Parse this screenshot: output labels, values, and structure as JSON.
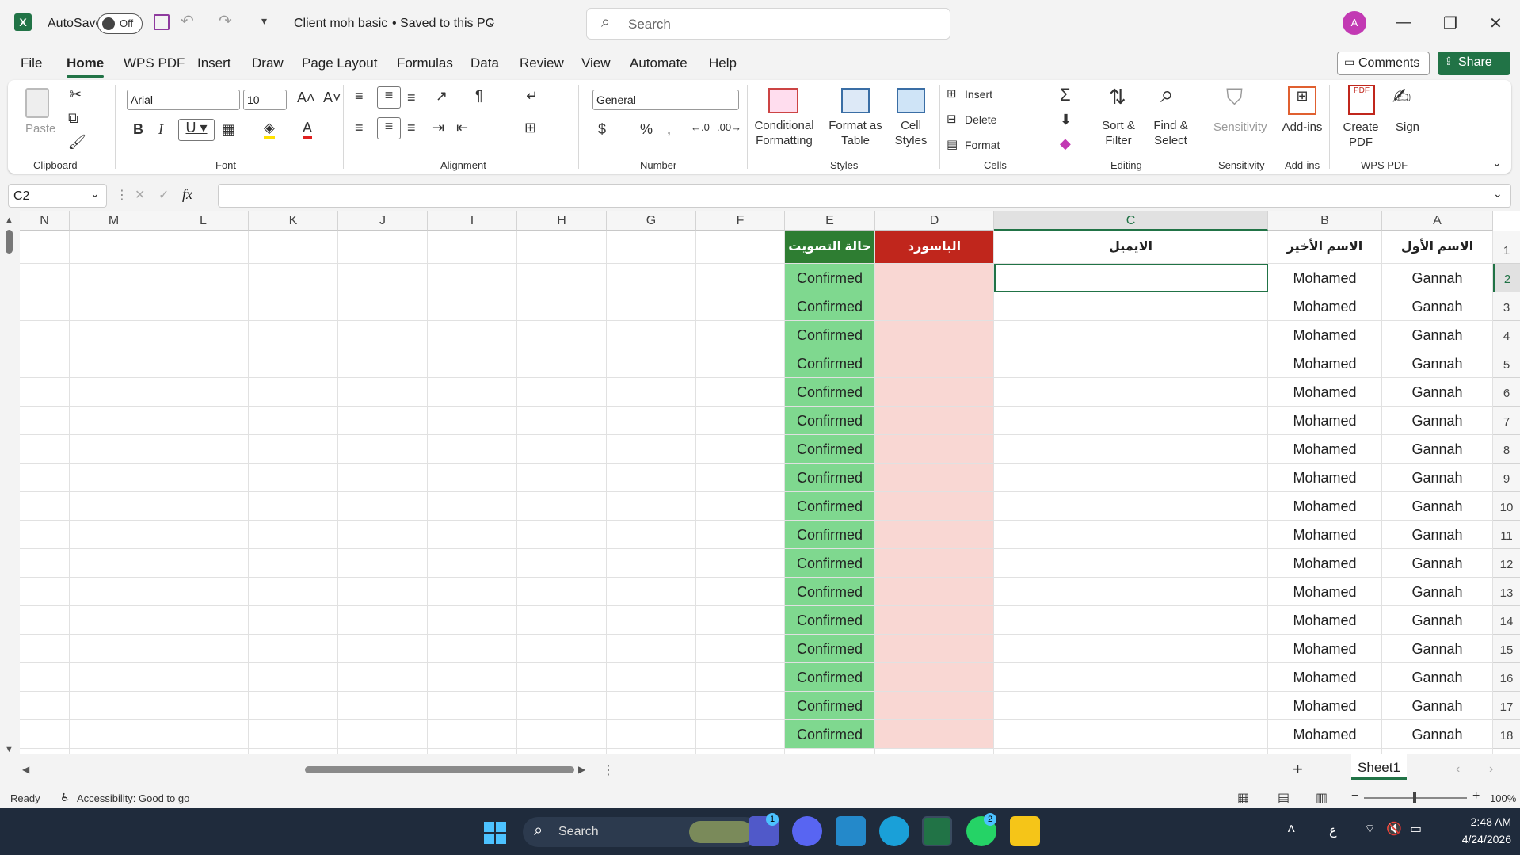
{
  "titlebar": {
    "autosave_label": "AutoSave",
    "autosave_state": "Off",
    "doc_title": "Client moh basic",
    "save_status": "• Saved to this PC",
    "search_placeholder": "Search",
    "avatar_initial": "A"
  },
  "menu": {
    "items": [
      "File",
      "Home",
      "WPS PDF",
      "Insert",
      "Draw",
      "Page Layout",
      "Formulas",
      "Data",
      "Review",
      "View",
      "Automate",
      "Help"
    ],
    "active": "Home",
    "comments": "Comments",
    "share": "Share"
  },
  "ribbon": {
    "clipboard": {
      "paste": "Paste",
      "label": "Clipboard"
    },
    "font": {
      "family": "Arial",
      "size": "10",
      "label": "Font"
    },
    "alignment": {
      "label": "Alignment"
    },
    "number": {
      "format": "General",
      "label": "Number"
    },
    "styles": {
      "conditional": "Conditional Formatting",
      "format_table": "Format as Table",
      "cell_styles": "Cell Styles",
      "label": "Styles"
    },
    "cells": {
      "insert": "Insert",
      "delete": "Delete",
      "format": "Format",
      "label": "Cells"
    },
    "editing": {
      "sort": "Sort & Filter",
      "find": "Find & Select",
      "label": "Editing"
    },
    "sensitivity": {
      "btn": "Sensitivity",
      "label": "Sensitivity"
    },
    "addins": {
      "btn": "Add-ins",
      "label": "Add-ins"
    },
    "wpspdf": {
      "create": "Create PDF",
      "sign": "Sign",
      "label": "WPS PDF"
    }
  },
  "formula_bar": {
    "name_box": "C2",
    "fx": "fx",
    "value": ""
  },
  "sheet": {
    "columns": [
      "N",
      "M",
      "L",
      "K",
      "J",
      "I",
      "H",
      "G",
      "F",
      "E",
      "D",
      "C",
      "B",
      "A"
    ],
    "selected_column": "C",
    "rows": [
      "1",
      "2",
      "3",
      "4",
      "5",
      "6",
      "7",
      "8",
      "9",
      "10",
      "11",
      "12",
      "13",
      "14",
      "15",
      "16",
      "17",
      "18"
    ],
    "selected_row": "2",
    "headers": {
      "A": "الاسم الأول",
      "B": "الاسم الأخير",
      "C": "الايميل",
      "D": "الباسورد",
      "E": "حالة التصويت"
    },
    "first_name": "Gannah",
    "last_name": "Mohamed",
    "status": "Confirmed",
    "colors": {
      "status_header": "#2e7d32",
      "status_fill": "#7fd88f",
      "password_header": "#c0261c",
      "password_fill": "#f9d7d3",
      "accent": "#217346"
    }
  },
  "sheetbar": {
    "tab": "Sheet1",
    "add": "+"
  },
  "statusbar": {
    "ready": "Ready",
    "accessibility": "Accessibility: Good to go",
    "zoom": "100%"
  },
  "taskbar": {
    "search": "Search",
    "badge_teams": "1",
    "badge_whatsapp": "2",
    "lang": "ع",
    "time": "2:48 AM",
    "date": "4/24/2026"
  }
}
